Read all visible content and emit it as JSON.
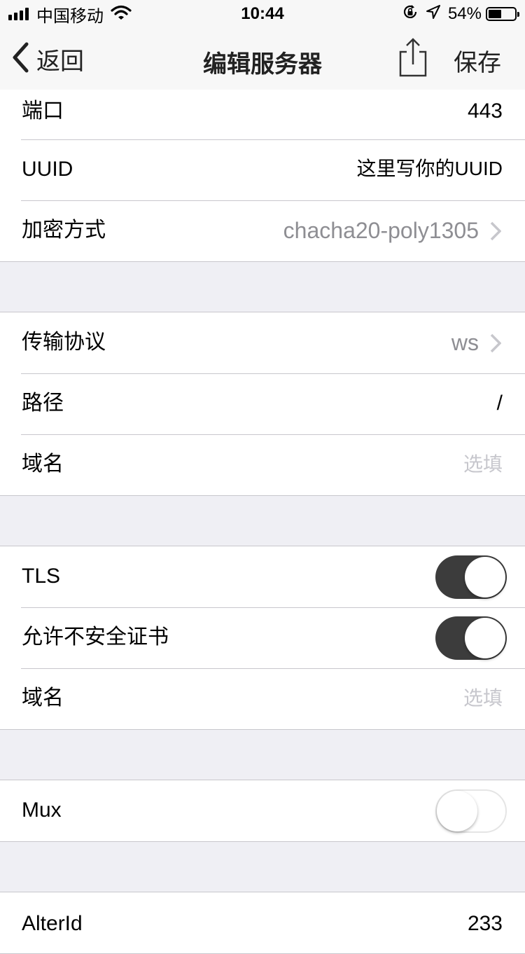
{
  "status_bar": {
    "carrier": "中国移动",
    "time": "10:44",
    "battery": "54%",
    "battery_level": 0.54,
    "icons": [
      "signal-icon",
      "wifi-icon",
      "rotation-lock-icon",
      "location-icon",
      "battery-icon"
    ]
  },
  "nav": {
    "back_label": "返回",
    "title": "编辑服务器",
    "save_label": "保存",
    "icons": [
      "chevron-left-icon",
      "share-icon"
    ]
  },
  "section1": {
    "port": {
      "label": "端口",
      "value": "443"
    },
    "uuid": {
      "label": "UUID",
      "value": "这里写你的UUID"
    },
    "encryption": {
      "label": "加密方式",
      "value": "chacha20-poly1305"
    }
  },
  "section2": {
    "transport": {
      "label": "传输协议",
      "value": "ws"
    },
    "path": {
      "label": "路径",
      "value": "/"
    },
    "domain": {
      "label": "域名",
      "placeholder": "选填"
    }
  },
  "section3": {
    "tls": {
      "label": "TLS",
      "on": true
    },
    "insecure": {
      "label": "允许不安全证书",
      "on": true
    },
    "domain": {
      "label": "域名",
      "placeholder": "选填"
    }
  },
  "section4": {
    "mux": {
      "label": "Mux",
      "on": false
    }
  },
  "section5": {
    "alterid": {
      "label": "AlterId",
      "value": "233"
    }
  },
  "colors": {
    "background": "#efeff4",
    "toggle_on": "#3c3c3c",
    "secondary_text": "#8e8e93",
    "placeholder_text": "#c7c7cd"
  }
}
